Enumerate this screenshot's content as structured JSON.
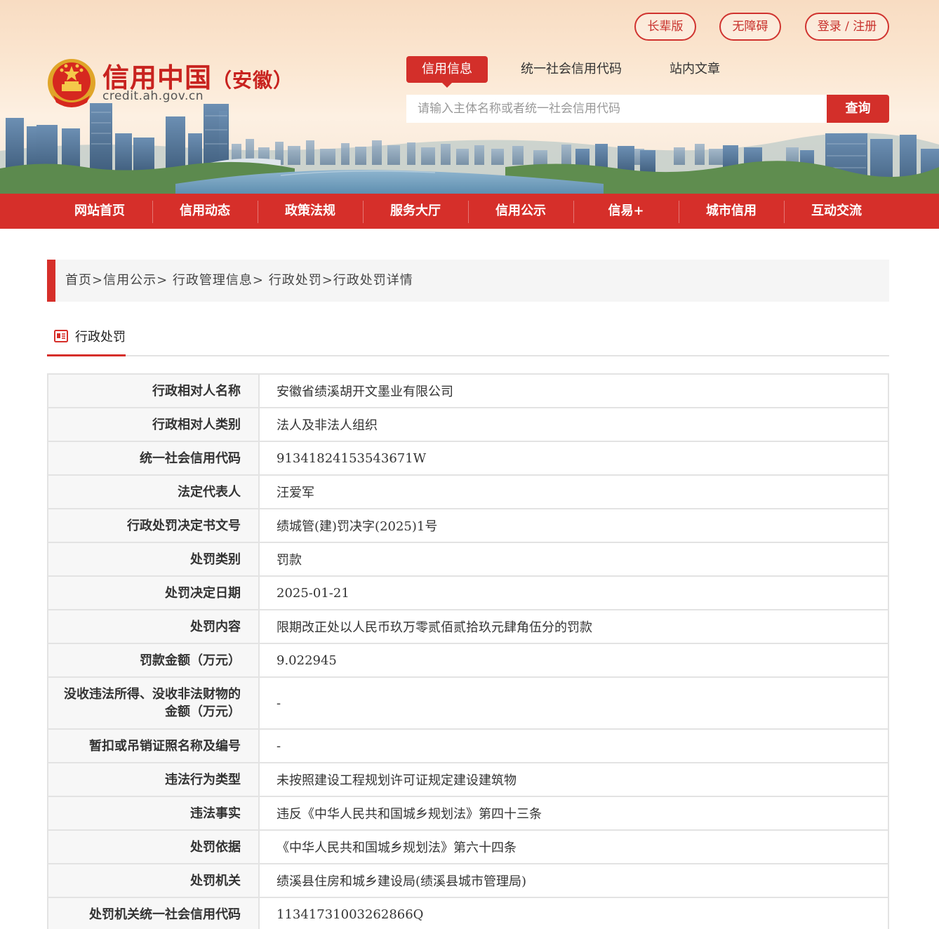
{
  "top_buttons": {
    "elder": "长辈版",
    "accessibility": "无障碍",
    "login": "登录 / 注册"
  },
  "logo": {
    "title": "信用中国",
    "province": "（安徽）",
    "url": "credit.ah.gov.cn"
  },
  "search": {
    "tabs": [
      {
        "label": "信用信息",
        "active": true
      },
      {
        "label": "统一社会信用代码",
        "active": false
      },
      {
        "label": "站内文章",
        "active": false
      }
    ],
    "placeholder": "请输入主体名称或者统一社会信用代码",
    "button": "查询"
  },
  "nav": [
    {
      "label": "网站首页"
    },
    {
      "label": "信用动态"
    },
    {
      "label": "政策法规"
    },
    {
      "label": "服务大厅"
    },
    {
      "label": "信用公示"
    },
    {
      "label": "信易+"
    },
    {
      "label": "城市信用"
    },
    {
      "label": "互动交流"
    }
  ],
  "breadcrumb": "首页>信用公示> 行政管理信息> 行政处罚>行政处罚详情",
  "section_title": "行政处罚",
  "rows": [
    {
      "label": "行政相对人名称",
      "value": "安徽省绩溪胡开文墨业有限公司"
    },
    {
      "label": "行政相对人类别",
      "value": "法人及非法人组织"
    },
    {
      "label": "统一社会信用代码",
      "value": "91341824153543671W"
    },
    {
      "label": "法定代表人",
      "value": "汪爱军"
    },
    {
      "label": "行政处罚决定书文号",
      "value": "绩城管(建)罚决字(2025)1号"
    },
    {
      "label": "处罚类别",
      "value": "罚款"
    },
    {
      "label": "处罚决定日期",
      "value": "2025-01-21"
    },
    {
      "label": "处罚内容",
      "value": "限期改正处以人民币玖万零贰佰贰拾玖元肆角伍分的罚款"
    },
    {
      "label": "罚款金额（万元）",
      "value": "9.022945"
    },
    {
      "label": "没收违法所得、没收非法财物的金额（万元）",
      "value": "-"
    },
    {
      "label": "暂扣或吊销证照名称及编号",
      "value": "-"
    },
    {
      "label": "违法行为类型",
      "value": "未按照建设工程规划许可证规定建设建筑物"
    },
    {
      "label": "违法事实",
      "value": "违反《中华人民共和国城乡规划法》第四十三条"
    },
    {
      "label": "处罚依据",
      "value": "《中华人民共和国城乡规划法》第六十四条"
    },
    {
      "label": "处罚机关",
      "value": "绩溪县住房和城乡建设局(绩溪县城市管理局)"
    },
    {
      "label": "处罚机关统一社会信用代码",
      "value": "11341731003262866Q"
    }
  ],
  "colors": {
    "brand_red": "#d62f2a",
    "label_bg": "#f7f7f7",
    "border": "#e3e3e3"
  },
  "icons": [
    "national-emblem-icon",
    "news-icon"
  ]
}
